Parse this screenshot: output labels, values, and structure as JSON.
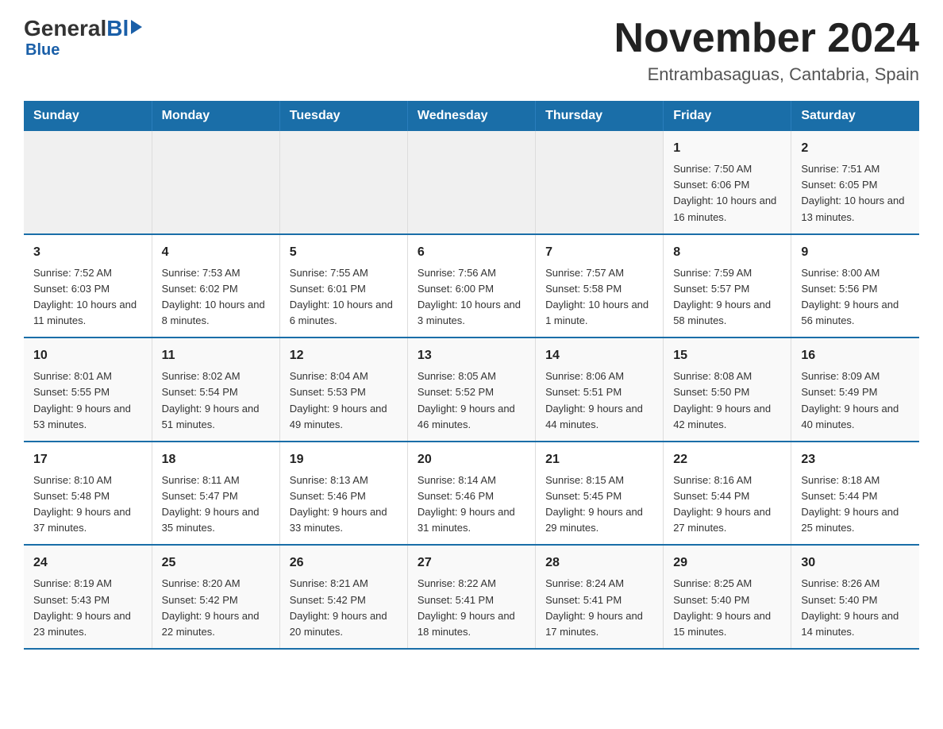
{
  "logo": {
    "general": "General",
    "blue": "Blue",
    "subtitle": "Blue"
  },
  "header": {
    "month_title": "November 2024",
    "location": "Entrambasaguas, Cantabria, Spain"
  },
  "weekdays": [
    "Sunday",
    "Monday",
    "Tuesday",
    "Wednesday",
    "Thursday",
    "Friday",
    "Saturday"
  ],
  "weeks": [
    [
      {
        "day": "",
        "sunrise": "",
        "sunset": "",
        "daylight": ""
      },
      {
        "day": "",
        "sunrise": "",
        "sunset": "",
        "daylight": ""
      },
      {
        "day": "",
        "sunrise": "",
        "sunset": "",
        "daylight": ""
      },
      {
        "day": "",
        "sunrise": "",
        "sunset": "",
        "daylight": ""
      },
      {
        "day": "",
        "sunrise": "",
        "sunset": "",
        "daylight": ""
      },
      {
        "day": "1",
        "sunrise": "Sunrise: 7:50 AM",
        "sunset": "Sunset: 6:06 PM",
        "daylight": "Daylight: 10 hours and 16 minutes."
      },
      {
        "day": "2",
        "sunrise": "Sunrise: 7:51 AM",
        "sunset": "Sunset: 6:05 PM",
        "daylight": "Daylight: 10 hours and 13 minutes."
      }
    ],
    [
      {
        "day": "3",
        "sunrise": "Sunrise: 7:52 AM",
        "sunset": "Sunset: 6:03 PM",
        "daylight": "Daylight: 10 hours and 11 minutes."
      },
      {
        "day": "4",
        "sunrise": "Sunrise: 7:53 AM",
        "sunset": "Sunset: 6:02 PM",
        "daylight": "Daylight: 10 hours and 8 minutes."
      },
      {
        "day": "5",
        "sunrise": "Sunrise: 7:55 AM",
        "sunset": "Sunset: 6:01 PM",
        "daylight": "Daylight: 10 hours and 6 minutes."
      },
      {
        "day": "6",
        "sunrise": "Sunrise: 7:56 AM",
        "sunset": "Sunset: 6:00 PM",
        "daylight": "Daylight: 10 hours and 3 minutes."
      },
      {
        "day": "7",
        "sunrise": "Sunrise: 7:57 AM",
        "sunset": "Sunset: 5:58 PM",
        "daylight": "Daylight: 10 hours and 1 minute."
      },
      {
        "day": "8",
        "sunrise": "Sunrise: 7:59 AM",
        "sunset": "Sunset: 5:57 PM",
        "daylight": "Daylight: 9 hours and 58 minutes."
      },
      {
        "day": "9",
        "sunrise": "Sunrise: 8:00 AM",
        "sunset": "Sunset: 5:56 PM",
        "daylight": "Daylight: 9 hours and 56 minutes."
      }
    ],
    [
      {
        "day": "10",
        "sunrise": "Sunrise: 8:01 AM",
        "sunset": "Sunset: 5:55 PM",
        "daylight": "Daylight: 9 hours and 53 minutes."
      },
      {
        "day": "11",
        "sunrise": "Sunrise: 8:02 AM",
        "sunset": "Sunset: 5:54 PM",
        "daylight": "Daylight: 9 hours and 51 minutes."
      },
      {
        "day": "12",
        "sunrise": "Sunrise: 8:04 AM",
        "sunset": "Sunset: 5:53 PM",
        "daylight": "Daylight: 9 hours and 49 minutes."
      },
      {
        "day": "13",
        "sunrise": "Sunrise: 8:05 AM",
        "sunset": "Sunset: 5:52 PM",
        "daylight": "Daylight: 9 hours and 46 minutes."
      },
      {
        "day": "14",
        "sunrise": "Sunrise: 8:06 AM",
        "sunset": "Sunset: 5:51 PM",
        "daylight": "Daylight: 9 hours and 44 minutes."
      },
      {
        "day": "15",
        "sunrise": "Sunrise: 8:08 AM",
        "sunset": "Sunset: 5:50 PM",
        "daylight": "Daylight: 9 hours and 42 minutes."
      },
      {
        "day": "16",
        "sunrise": "Sunrise: 8:09 AM",
        "sunset": "Sunset: 5:49 PM",
        "daylight": "Daylight: 9 hours and 40 minutes."
      }
    ],
    [
      {
        "day": "17",
        "sunrise": "Sunrise: 8:10 AM",
        "sunset": "Sunset: 5:48 PM",
        "daylight": "Daylight: 9 hours and 37 minutes."
      },
      {
        "day": "18",
        "sunrise": "Sunrise: 8:11 AM",
        "sunset": "Sunset: 5:47 PM",
        "daylight": "Daylight: 9 hours and 35 minutes."
      },
      {
        "day": "19",
        "sunrise": "Sunrise: 8:13 AM",
        "sunset": "Sunset: 5:46 PM",
        "daylight": "Daylight: 9 hours and 33 minutes."
      },
      {
        "day": "20",
        "sunrise": "Sunrise: 8:14 AM",
        "sunset": "Sunset: 5:46 PM",
        "daylight": "Daylight: 9 hours and 31 minutes."
      },
      {
        "day": "21",
        "sunrise": "Sunrise: 8:15 AM",
        "sunset": "Sunset: 5:45 PM",
        "daylight": "Daylight: 9 hours and 29 minutes."
      },
      {
        "day": "22",
        "sunrise": "Sunrise: 8:16 AM",
        "sunset": "Sunset: 5:44 PM",
        "daylight": "Daylight: 9 hours and 27 minutes."
      },
      {
        "day": "23",
        "sunrise": "Sunrise: 8:18 AM",
        "sunset": "Sunset: 5:44 PM",
        "daylight": "Daylight: 9 hours and 25 minutes."
      }
    ],
    [
      {
        "day": "24",
        "sunrise": "Sunrise: 8:19 AM",
        "sunset": "Sunset: 5:43 PM",
        "daylight": "Daylight: 9 hours and 23 minutes."
      },
      {
        "day": "25",
        "sunrise": "Sunrise: 8:20 AM",
        "sunset": "Sunset: 5:42 PM",
        "daylight": "Daylight: 9 hours and 22 minutes."
      },
      {
        "day": "26",
        "sunrise": "Sunrise: 8:21 AM",
        "sunset": "Sunset: 5:42 PM",
        "daylight": "Daylight: 9 hours and 20 minutes."
      },
      {
        "day": "27",
        "sunrise": "Sunrise: 8:22 AM",
        "sunset": "Sunset: 5:41 PM",
        "daylight": "Daylight: 9 hours and 18 minutes."
      },
      {
        "day": "28",
        "sunrise": "Sunrise: 8:24 AM",
        "sunset": "Sunset: 5:41 PM",
        "daylight": "Daylight: 9 hours and 17 minutes."
      },
      {
        "day": "29",
        "sunrise": "Sunrise: 8:25 AM",
        "sunset": "Sunset: 5:40 PM",
        "daylight": "Daylight: 9 hours and 15 minutes."
      },
      {
        "day": "30",
        "sunrise": "Sunrise: 8:26 AM",
        "sunset": "Sunset: 5:40 PM",
        "daylight": "Daylight: 9 hours and 14 minutes."
      }
    ]
  ]
}
